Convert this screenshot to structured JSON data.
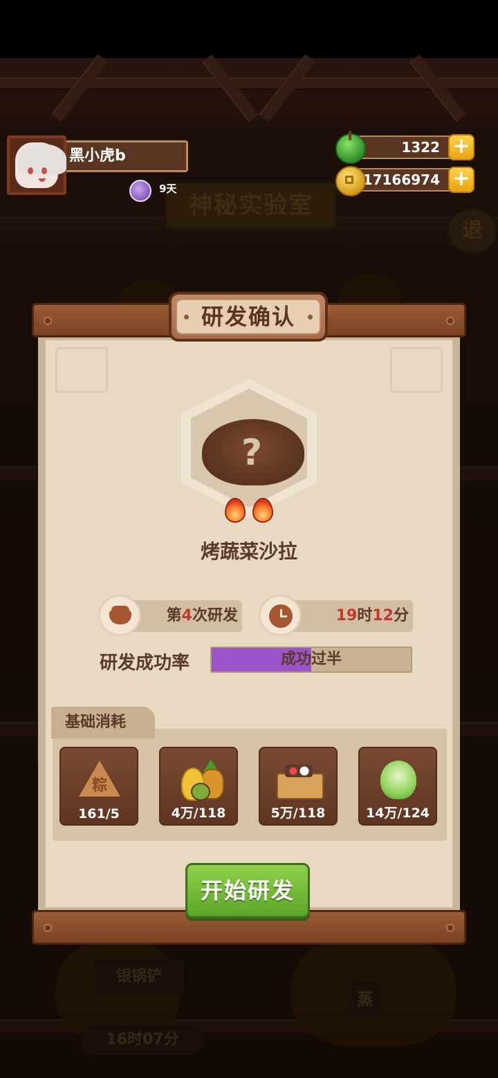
{
  "player": {
    "name": "黑小虎b",
    "vip_days": "9天"
  },
  "resources": {
    "jade": "1322",
    "coins": "17166974"
  },
  "background": {
    "room_title": "神秘实验室",
    "exit_label": "退",
    "tool_label": "银锅铲",
    "timer": "16时07分",
    "steam_label": "蒸"
  },
  "dialog": {
    "title": "研发确认",
    "dish_name": "烤蔬菜沙拉",
    "flames": 2,
    "attempt_prefix": "第",
    "attempt_number": "4",
    "attempt_suffix": "次研发",
    "time_hours": "19",
    "time_hours_unit": "时",
    "time_minutes": "12",
    "time_minutes_unit": "分",
    "success_rate_label": "研发成功率",
    "success_rate_text": "成功过半",
    "success_rate_fraction": 0.5,
    "cost_title": "基础消耗",
    "cost_items": [
      {
        "icon": "zongzi-icon",
        "count": "161/5"
      },
      {
        "icon": "fruit-basket-icon",
        "count": "4万/118"
      },
      {
        "icon": "ingredient-box-icon",
        "count": "5万/118"
      },
      {
        "icon": "cabbage-icon",
        "count": "14万/124"
      }
    ],
    "start_button": "开始研发"
  },
  "colors": {
    "accent_green": "#6fbf34",
    "rate_purple": "#9a53c9",
    "highlight_red": "#c0392b"
  }
}
